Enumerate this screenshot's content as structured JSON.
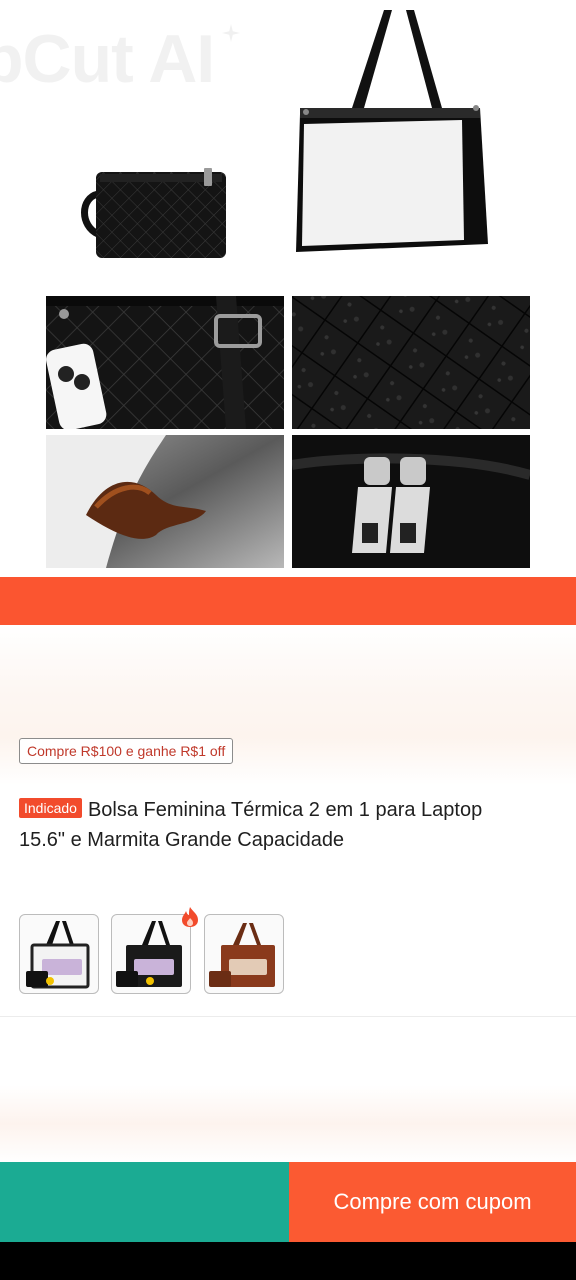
{
  "hero": {
    "watermark_text": "pCut AI",
    "icons": [
      "clutch-bag-image",
      "tote-bag-image",
      "phone-in-bag-detail",
      "quilted-texture-detail",
      "water-resistant-lining-detail",
      "zipper-detail"
    ]
  },
  "product": {
    "promo_chip": "Compre R$100 e ganhe R$1 off",
    "tag": "Indicado",
    "title": "Bolsa Feminina Térmica 2 em 1 para Laptop 15.6\" e Marmita Grande Capacidade",
    "variants": [
      "white-variant",
      "black-variant",
      "brown-variant"
    ]
  },
  "bottom_bar": {
    "buy_label": "Compre com cupom"
  },
  "colors": {
    "accent_orange": "#fb5530",
    "teal": "#1bab93",
    "tag_red": "#f24b2c"
  }
}
